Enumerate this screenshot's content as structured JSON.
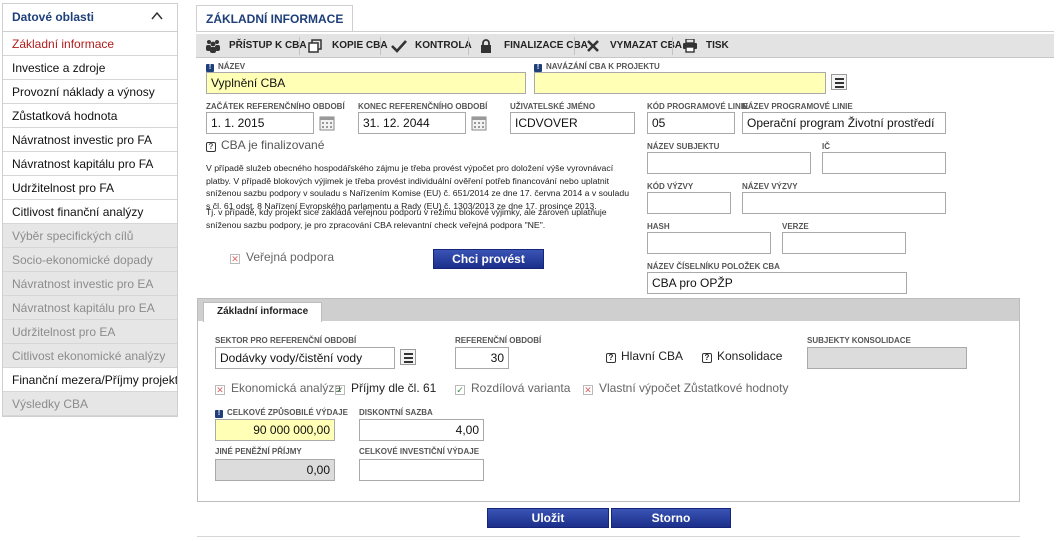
{
  "sidebar": {
    "title": "Datové oblasti",
    "items": [
      {
        "label": "Základní informace",
        "state": "active"
      },
      {
        "label": "Investice a zdroje",
        "state": "normal"
      },
      {
        "label": "Provozní náklady a výnosy",
        "state": "normal"
      },
      {
        "label": "Zůstatková hodnota",
        "state": "normal"
      },
      {
        "label": "Návratnost investic pro FA",
        "state": "normal"
      },
      {
        "label": "Návratnost kapitálu pro FA",
        "state": "normal"
      },
      {
        "label": "Udržitelnost pro FA",
        "state": "normal"
      },
      {
        "label": "Citlivost finanční analýzy",
        "state": "normal"
      },
      {
        "label": "Výběr specifických cílů",
        "state": "disabled"
      },
      {
        "label": "Socio-ekonomické dopady",
        "state": "disabled"
      },
      {
        "label": "Návratnost investic pro EA",
        "state": "disabled"
      },
      {
        "label": "Návratnost kapitálu pro EA",
        "state": "disabled"
      },
      {
        "label": "Udržitelnost pro EA",
        "state": "disabled"
      },
      {
        "label": "Citlivost ekonomické analýzy",
        "state": "disabled"
      },
      {
        "label": "Finanční mezera/Příjmy projektu",
        "state": "normal"
      },
      {
        "label": "Výsledky CBA",
        "state": "disabled"
      }
    ]
  },
  "main_tab": "ZÁKLADNÍ INFORMACE",
  "toolbar": {
    "access": "PŘÍSTUP K CBA",
    "copy": "KOPIE CBA",
    "check": "KONTROLA",
    "finalize": "FINALIZACE CBA",
    "delete": "VYMAZAT CBA",
    "print": "TISK"
  },
  "form": {
    "name_label": "NÁZEV",
    "name_value": "Vyplnění CBA",
    "link_label": "NAVÁZÁNÍ CBA K PROJEKTU",
    "link_value": "",
    "start_label": "ZAČÁTEK REFERENČNÍHO OBDOBÍ",
    "start_value": "1. 1. 2015",
    "end_label": "KONEC REFERENČNÍHO OBDOBÍ",
    "end_value": "31. 12. 2044",
    "user_label": "UŽIVATELSKÉ JMÉNO",
    "user_value": "ICDVOVER",
    "prog_code_label": "KÓD PROGRAMOVÉ LINIE",
    "prog_code_value": "05",
    "prog_name_label": "NÁZEV PROGRAMOVÉ LINIE",
    "prog_name_value": "Operační program Životní prostředí",
    "finalized_label": "CBA je finalizované",
    "subject_label": "NÁZEV SUBJEKTU",
    "subject_value": "",
    "ic_label": "IČ",
    "ic_value": "",
    "call_code_label": "KÓD VÝZVY",
    "call_code_value": "",
    "call_name_label": "NÁZEV VÝZVY",
    "call_name_value": "",
    "hash_label": "HASH",
    "hash_value": "",
    "version_label": "VERZE",
    "version_value": "",
    "catalog_label": "NÁZEV ČÍSELNÍKU POLOŽEK CBA",
    "catalog_value": "CBA pro OPŽP",
    "info_lines": [
      "V případě služeb obecného hospodářského zájmu je třeba provést výpočet pro doložení výše vyrovnávací",
      "platby. V případě blokových výjimek je třeba provést individuální ověření potřeb financování nebo uplatnit",
      "sníženou sazbu podpory v souladu s Nařízením Komise (EU) č. 651/2014 ze dne 17. června 2014 a v souladu",
      "s čl. 61 odst. 8 Nařízení Evropského parlamentu a Rady (EU) č. 1303/2013 ze dne 17. prosince 2013.",
      "Tj. v případě, kdy projekt sice zakládá veřejnou podporu v režimu blokové výjimky, ale zároveň uplatňuje",
      "sníženou sazbu podpory, je pro zpracování CBA relevantní check veřejná podpora \"NE\"."
    ],
    "public_support_label": "Veřejná podpora",
    "change_button": "Chci provést změnu"
  },
  "panel": {
    "tab": "Základní informace",
    "sector_label": "SEKTOR PRO REFERENČNÍ OBDOBÍ",
    "sector_value": "Dodávky vody/čistění vody",
    "ref_period_label": "REFERENČNÍ OBDOBÍ",
    "ref_period_value": "30",
    "main_cba_label": "Hlavní CBA",
    "consolidation_label": "Konsolidace",
    "consolidation_subjects_label": "SUBJEKTY KONSOLIDACE",
    "consolidation_subjects_value": "",
    "economic_analysis_label": "Ekonomická analýza",
    "income_label": "Příjmy dle čl. 61",
    "differential_label": "Rozdílová varianta",
    "own_residual_label": "Vlastní výpočet Zůstatkové hodnoty",
    "eligible_label": "CELKOVÉ ZPŮSOBILÉ VÝDAJE",
    "eligible_value": "90 000 000,00",
    "discount_label": "DISKONTNÍ SAZBA",
    "discount_value": "4,00",
    "other_income_label": "JINÉ PENĚŽNÍ PŘÍJMY",
    "other_income_value": "0,00",
    "total_investment_label": "CELKOVÉ INVESTIČNÍ VÝDAJE",
    "total_investment_value": ""
  },
  "actions": {
    "save": "Uložit",
    "cancel": "Storno"
  },
  "colors": {
    "brand_blue": "#1e3f7a",
    "active_red": "#b11d1d",
    "required_yellow": "#ffffb5"
  }
}
